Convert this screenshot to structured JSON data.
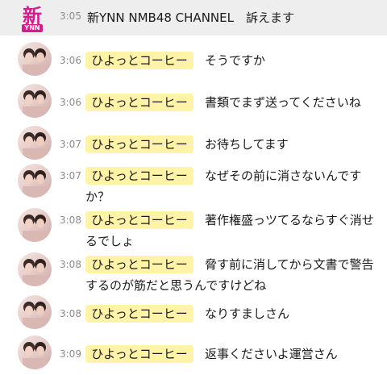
{
  "header": {
    "logo_main": "新",
    "logo_sub": "YNN",
    "time": "3:05",
    "text": "新YNN NMB48 CHANNEL　訴えます"
  },
  "messages": [
    {
      "time": "3:06",
      "author": "ひよっとコーヒー",
      "text": "そうですか"
    },
    {
      "time": "3:06",
      "author": "ひよっとコーヒー",
      "text": "書類でまず送ってくださいね"
    },
    {
      "time": "3:07",
      "author": "ひよっとコーヒー",
      "text": "お待ちしてます"
    },
    {
      "time": "3:07",
      "author": "ひよっとコーヒー",
      "text": "なぜその前に消さないんですか？"
    },
    {
      "time": "3:08",
      "author": "ひよっとコーヒー",
      "text": "著作権盛っツてるならすぐ消せるでしょ"
    },
    {
      "time": "3:08",
      "author": "ひよっとコーヒー",
      "text": "脅す前に消してから文書で警告するのが筋だと思うんですけどね"
    },
    {
      "time": "3:08",
      "author": "ひよっとコーヒー",
      "text": "なりすましさん"
    },
    {
      "time": "3:09",
      "author": "ひよっとコーヒー",
      "text": "返事くださいよ運営さん"
    }
  ],
  "colors": {
    "header_bg": "#eeeeee",
    "author_badge": "#fff3a8",
    "logo": "#d81b8c",
    "timestamp": "#8a8a8a"
  }
}
